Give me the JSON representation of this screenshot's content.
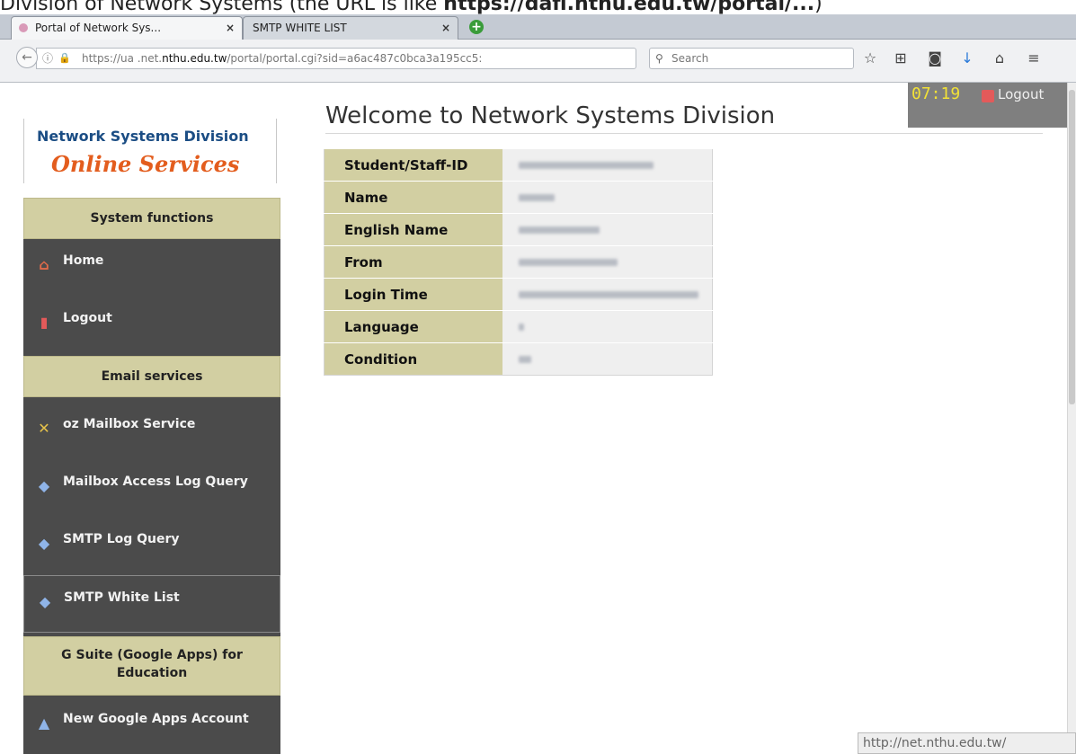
{
  "caption": {
    "prefix": "Division of Network Systems (the URL is like ",
    "url_bold": "https://dafl.nthu.edu.tw/portal/...",
    "suffix": ")"
  },
  "browser": {
    "tabs": [
      {
        "label": "Portal of Network Sys...",
        "close": "×",
        "active": true
      },
      {
        "label": "SMTP WHITE LIST",
        "close": "×",
        "active": false
      }
    ],
    "new_tab": "+",
    "url_prefix": "https://ua  .net.",
    "url_domain": "nthu.edu.tw",
    "url_suffix": "/portal/portal.cgi?sid=a6ac487c0bca3a195cc5:",
    "info_icon": "ⓘ",
    "lock_icon": "🔒",
    "reload": "C",
    "search_placeholder": "Search",
    "toolbar_icons": [
      "☆",
      "⊞",
      "◙",
      "↓",
      "⌂",
      "≡"
    ]
  },
  "logo": {
    "line1": "Network Systems Division",
    "line2": "Online Services"
  },
  "sidebar": {
    "sections": [
      {
        "title": "System functions",
        "items": [
          {
            "label": "Home",
            "icon": "home-icon"
          },
          {
            "label": "Logout",
            "icon": "logout-icon"
          }
        ]
      },
      {
        "title": "Email services",
        "items": [
          {
            "label": "oz Mailbox Service",
            "icon": "tools-icon"
          },
          {
            "label": "Mailbox Access Log Query",
            "icon": "log-search-icon"
          },
          {
            "label": "SMTP Log Query",
            "icon": "log-search-icon"
          },
          {
            "label": "SMTP White List",
            "icon": "whitelist-icon"
          }
        ]
      },
      {
        "title": "G Suite (Google Apps) for Education",
        "items": [
          {
            "label": "New Google Apps Account",
            "icon": "account-icon"
          }
        ]
      }
    ]
  },
  "main": {
    "title": "Welcome to Network Systems Division",
    "table": [
      {
        "key": "Student/Staff-ID"
      },
      {
        "key": "Name"
      },
      {
        "key": "English Name"
      },
      {
        "key": "From"
      },
      {
        "key": "Login Time"
      },
      {
        "key": "Language"
      },
      {
        "key": "Condition"
      }
    ]
  },
  "session": {
    "timer": "07:19",
    "logout_label": "Logout"
  },
  "status_url": "http://net.nthu.edu.tw/",
  "colors": {
    "sidebar_bg": "#4b4b4b",
    "section_head": "#d2cfa2",
    "logo_blue": "#1b4d84",
    "logo_orange": "#e35d1e",
    "timer_yellow": "#f3e236"
  }
}
